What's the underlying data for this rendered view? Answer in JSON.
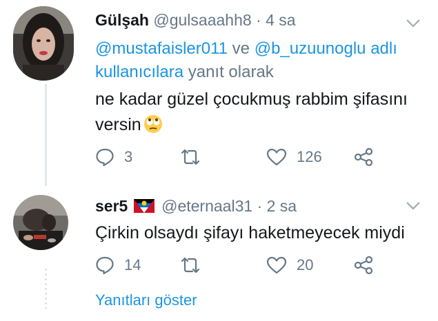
{
  "tweet1": {
    "display_name": "Gülşah",
    "handle": "@gulsaaahh8",
    "separator": "·",
    "time": "4 sa",
    "reply_mention_1": "@mustafaisler011",
    "reply_conj": "ve",
    "reply_mention_2": "@b_uzuunoglu",
    "reply_tail_link": "adlı kullanıcılara",
    "reply_suffix": "yanıt olarak",
    "text_line1": "ne kadar güzel çocukmuş rabbim şifasını",
    "text_line2": "versin",
    "emoji": "rolling-eyes-emoji",
    "replies": "3",
    "likes": "126"
  },
  "tweet2": {
    "display_name": "ser5",
    "flag": "antigua-barbuda-flag",
    "handle": "@eternaal31",
    "separator": "·",
    "time": "2 sa",
    "text": "Çirkin olsaydı şifayı haketmeyecek miydi",
    "replies": "14",
    "likes": "20"
  },
  "show_replies_label": "Yanıtları göster",
  "colors": {
    "link": "#1b95e0",
    "muted": "#657786",
    "text": "#14171a",
    "line": "#e1e8ed"
  }
}
